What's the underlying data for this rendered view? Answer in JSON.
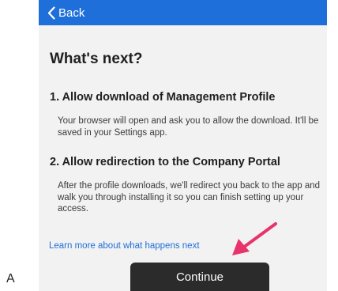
{
  "caption_letter": "A",
  "nav": {
    "back_label": "Back"
  },
  "page": {
    "title": "What's next?"
  },
  "steps": [
    {
      "title": "1. Allow download of Management Profile",
      "body": "Your browser will open and ask you to allow the download. It'll be saved in your Settings app."
    },
    {
      "title": "2. Allow redirection to the Company Portal",
      "body": "After the profile downloads, we'll redirect you back to the app and walk you through installing it so you can finish setting up your access."
    }
  ],
  "learn_more_label": "Learn more about what happens next",
  "continue_label": "Continue",
  "colors": {
    "nav_blue": "#1e6fd9",
    "annotation_arrow": "#e8336b",
    "button_dark": "#2b2b2b"
  },
  "icons": {
    "back": "chevron-left-icon",
    "annotation": "arrow-annotation"
  }
}
